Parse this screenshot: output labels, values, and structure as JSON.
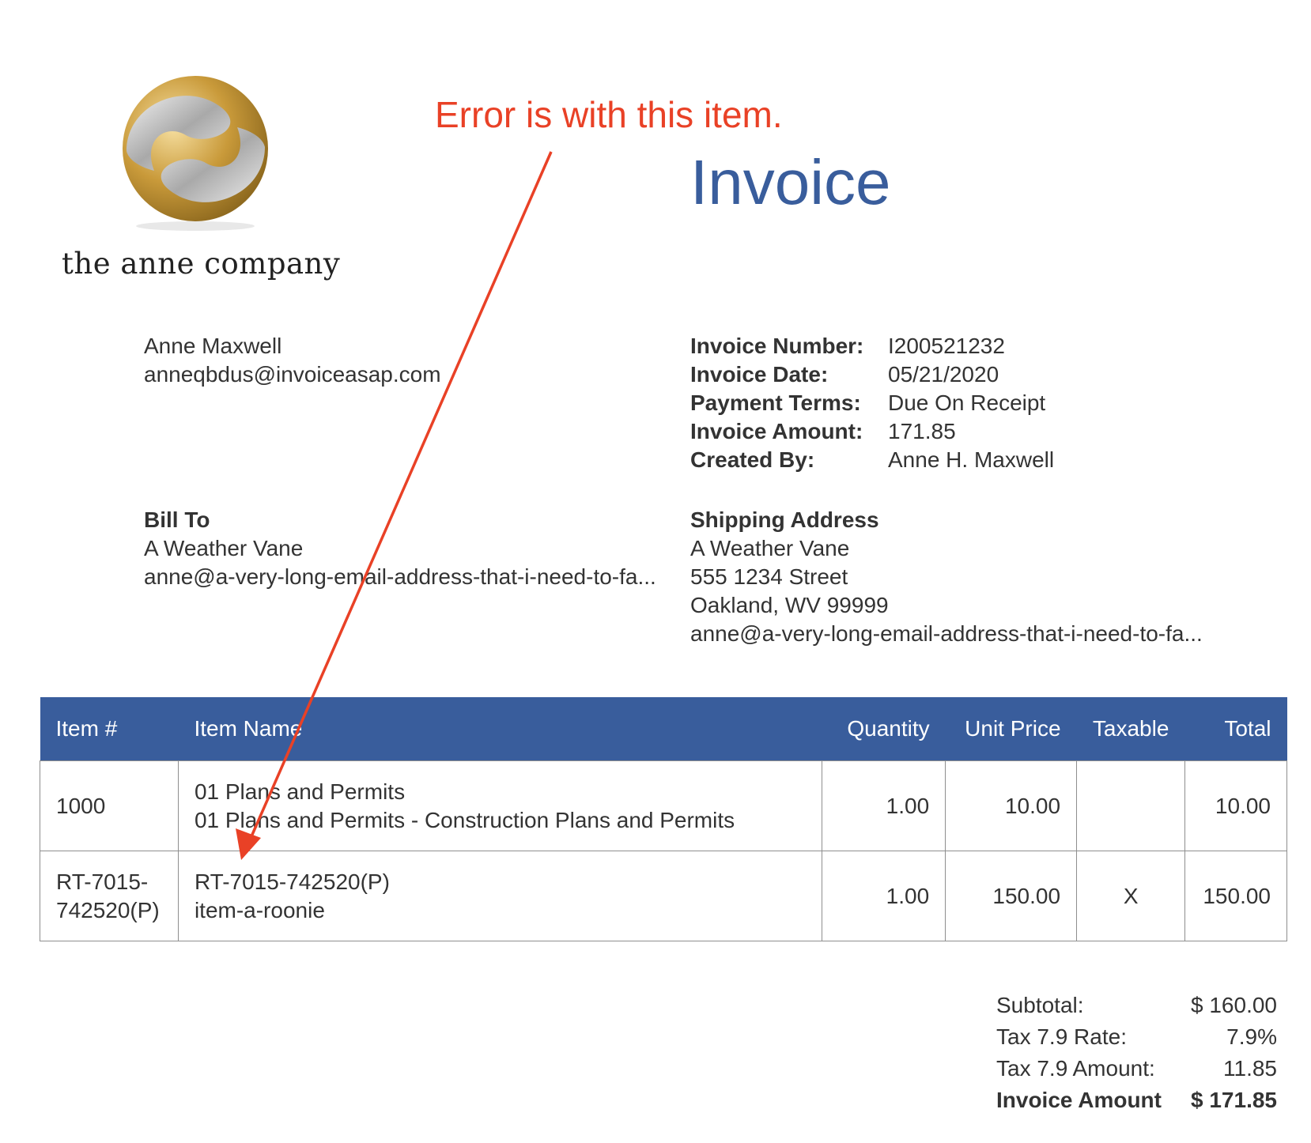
{
  "annotation": {
    "text": "Error is with this item.",
    "color": "#e94126"
  },
  "company": {
    "name": "the anne company",
    "logo_icon": "gold-silver-swirl-sphere-logo"
  },
  "invoice": {
    "title": "Invoice",
    "accent_color": "#395d9c"
  },
  "sender": {
    "name": "Anne Maxwell",
    "email": "anneqbdus@invoiceasap.com"
  },
  "meta": [
    {
      "label": "Invoice Number:",
      "value": "I200521232"
    },
    {
      "label": "Invoice Date:",
      "value": "05/21/2020"
    },
    {
      "label": "Payment Terms:",
      "value": "Due On Receipt"
    },
    {
      "label": "Invoice Amount:",
      "value": "171.85"
    },
    {
      "label": "Created By:",
      "value": "Anne H. Maxwell"
    }
  ],
  "bill_to": {
    "heading": "Bill To",
    "name": "A Weather Vane",
    "email": "anne@a-very-long-email-address-that-i-need-to-fa..."
  },
  "shipping": {
    "heading": "Shipping Address",
    "name": "A Weather Vane",
    "street": "555 1234 Street",
    "city": "Oakland, WV 99999",
    "email": "anne@a-very-long-email-address-that-i-need-to-fa..."
  },
  "table": {
    "headers": [
      "Item #",
      "Item Name",
      "Quantity",
      "Unit Price",
      "Taxable",
      "Total"
    ],
    "rows": [
      {
        "item_no_1": "1000",
        "item_no_2": "",
        "name_1": "01 Plans and Permits",
        "name_2": "01 Plans and Permits - Construction Plans and Permits",
        "quantity": "1.00",
        "unit_price": "10.00",
        "taxable": "",
        "total": "10.00"
      },
      {
        "item_no_1": "RT-7015-",
        "item_no_2": "742520(P)",
        "name_1": "RT-7015-742520(P)",
        "name_2": "item-a-roonie",
        "quantity": "1.00",
        "unit_price": "150.00",
        "taxable": "X",
        "total": "150.00"
      }
    ]
  },
  "summary": [
    {
      "label": "Subtotal:",
      "value": "$ 160.00"
    },
    {
      "label": "Tax 7.9 Rate:",
      "value": "7.9%"
    },
    {
      "label": "Tax 7.9 Amount:",
      "value": "11.85"
    },
    {
      "label": "Invoice Amount",
      "value": "$ 171.85"
    }
  ]
}
